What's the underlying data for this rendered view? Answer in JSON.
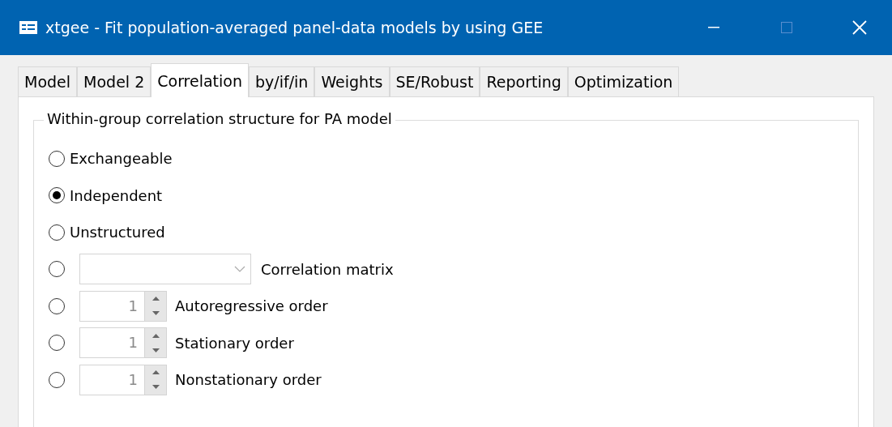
{
  "window": {
    "title": "xtgee - Fit population-averaged panel-data models by using GEE"
  },
  "tabs": [
    {
      "label": "Model",
      "selected": false
    },
    {
      "label": "Model 2",
      "selected": false
    },
    {
      "label": "Correlation",
      "selected": true
    },
    {
      "label": "by/if/in",
      "selected": false
    },
    {
      "label": "Weights",
      "selected": false
    },
    {
      "label": "SE/Robust",
      "selected": false
    },
    {
      "label": "Reporting",
      "selected": false
    },
    {
      "label": "Optimization",
      "selected": false
    }
  ],
  "group": {
    "title": "Within-group correlation structure for PA model",
    "options": [
      {
        "kind": "plain",
        "label": "Exchangeable",
        "selected": false
      },
      {
        "kind": "plain",
        "label": "Independent",
        "selected": true
      },
      {
        "kind": "plain",
        "label": "Unstructured",
        "selected": false
      },
      {
        "kind": "combo",
        "label": "Correlation matrix",
        "selected": false
      },
      {
        "kind": "spin",
        "label": "Autoregressive order",
        "value": "1",
        "selected": false
      },
      {
        "kind": "spin",
        "label": "Stationary order",
        "value": "1",
        "selected": false
      },
      {
        "kind": "spin",
        "label": "Nonstationary order",
        "value": "1",
        "selected": false
      }
    ]
  }
}
